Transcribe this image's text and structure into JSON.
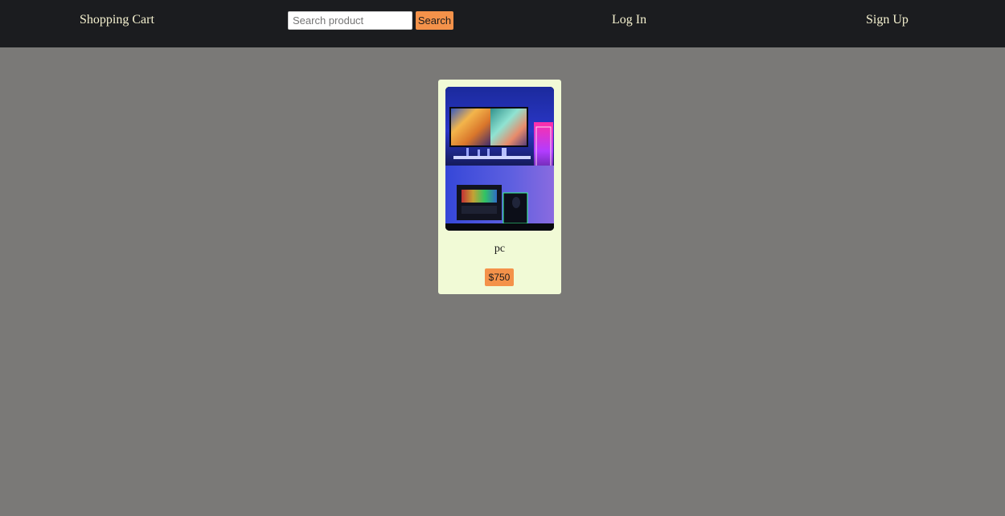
{
  "header": {
    "brand": "Shopping Cart",
    "search": {
      "placeholder": "Search product",
      "value": "",
      "button_label": "Search"
    },
    "login_label": "Log In",
    "signup_label": "Sign Up"
  },
  "products": [
    {
      "name": "pc",
      "price": "$750",
      "image": "gaming-pc-setup-photo"
    }
  ],
  "colors": {
    "header_bg": "#1b1c1f",
    "page_bg": "#7a7977",
    "nav_text": "#f5f1cf",
    "accent": "#f4924a",
    "card_bg": "#f1fad6"
  }
}
